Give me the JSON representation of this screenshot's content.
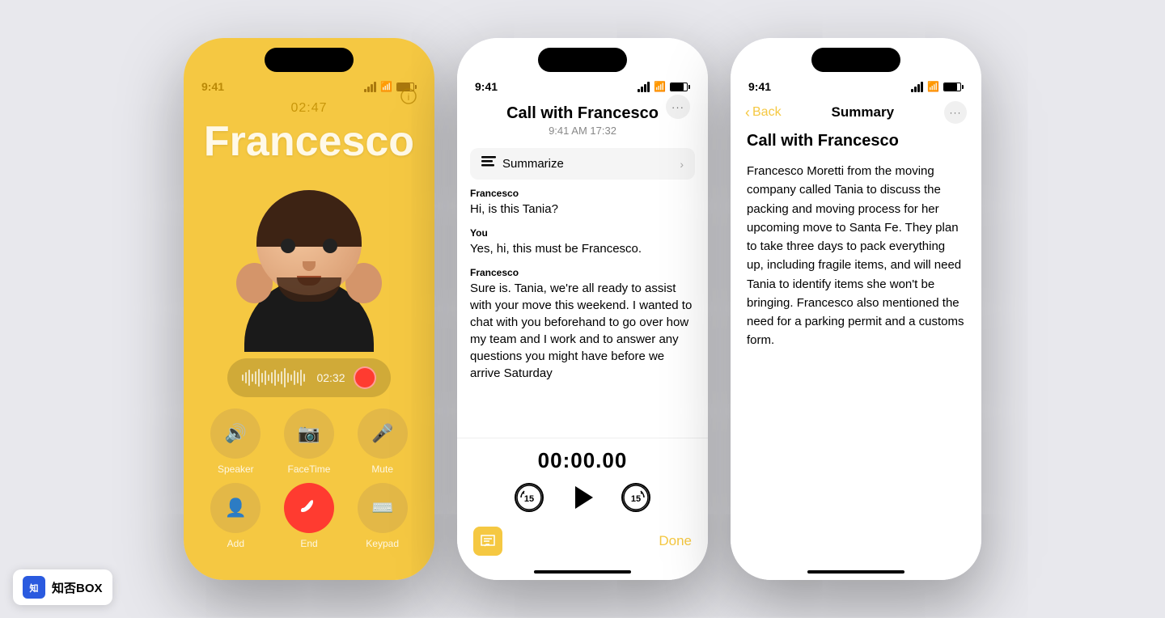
{
  "page": {
    "background": "#e8e8ed"
  },
  "phone1": {
    "status_time": "9:41",
    "call_timer": "02:47",
    "caller_name": "Francesco",
    "waveform_time": "02:32",
    "buttons": [
      {
        "icon": "🔊",
        "label": "Speaker"
      },
      {
        "icon": "📷",
        "label": "FaceTime"
      },
      {
        "icon": "🎤",
        "label": "Mute"
      },
      {
        "icon": "👤",
        "label": "Add"
      },
      {
        "icon": "📞",
        "label": "End",
        "type": "end"
      },
      {
        "icon": "⌨️",
        "label": "Keypad"
      }
    ]
  },
  "phone2": {
    "status_time": "9:41",
    "title": "Call with Francesco",
    "subtitle": "9:41 AM  17:32",
    "more_icon": "•••",
    "summarize_label": "Summarize",
    "transcript": [
      {
        "speaker": "Francesco",
        "text": "Hi, is this Tania?"
      },
      {
        "speaker": "You",
        "text": "Yes, hi, this must be Francesco."
      },
      {
        "speaker": "Francesco",
        "text": "Sure is. Tania, we're all ready to assist with your move this weekend. I wanted to chat with you beforehand to go over how my team and I work and to answer any questions you might have before we arrive Saturday"
      }
    ],
    "playback_time": "00:00.00",
    "skip_back_label": "15",
    "skip_forward_label": "15",
    "done_label": "Done"
  },
  "phone3": {
    "status_time": "9:41",
    "back_label": "Back",
    "nav_title": "Summary",
    "more_icon": "•••",
    "summary_title": "Call with Francesco",
    "summary_text": "Francesco Moretti from the moving company called Tania to discuss the packing and moving process for her upcoming move to Santa Fe. They plan to take three days to pack everything up, including fragile items, and will need Tania to identify items she won't be bringing. Francesco also mentioned the need for a parking permit and a customs form."
  },
  "watermark": {
    "icon_text": "知",
    "label": "知否BOX"
  }
}
